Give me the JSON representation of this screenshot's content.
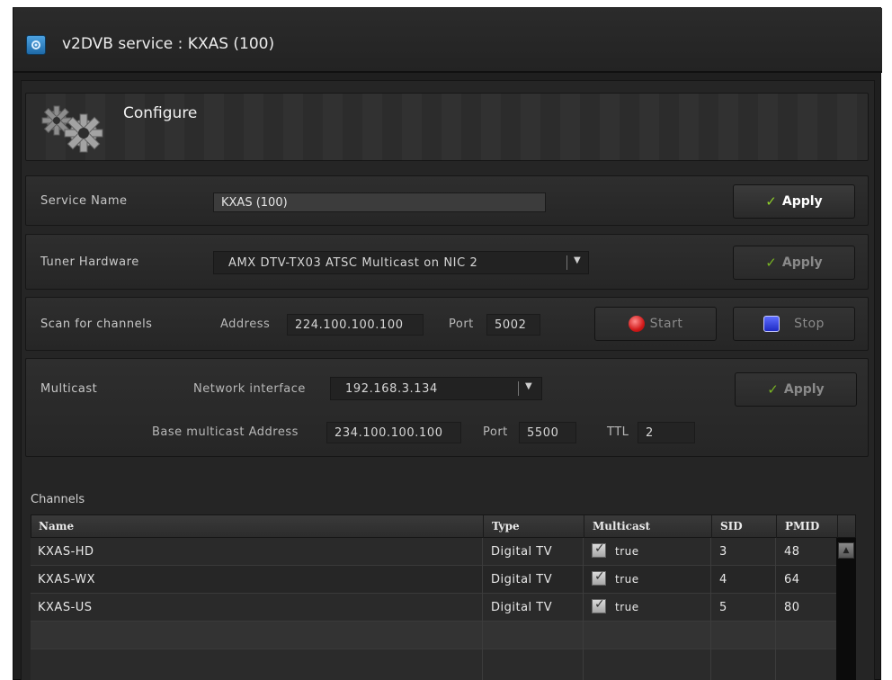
{
  "window": {
    "title": "v2DVB service : KXAS (100)"
  },
  "configure": {
    "title": "Configure"
  },
  "service_name": {
    "label": "Service Name",
    "value": "KXAS (100)",
    "apply_label": "Apply"
  },
  "tuner": {
    "label": "Tuner Hardware",
    "selected": "AMX DTV-TX03 ATSC Multicast on NIC 2",
    "apply_label": "Apply"
  },
  "scan": {
    "label": "Scan for channels",
    "address_label": "Address",
    "address": "224.100.100.100",
    "port_label": "Port",
    "port": "5002",
    "start_label": "Start",
    "stop_label": "Stop"
  },
  "multicast": {
    "label": "Multicast",
    "network_interface_label": "Network interface",
    "network_interface": "192.168.3.134",
    "apply_label": "Apply",
    "base_address_label": "Base multicast Address",
    "base_address": "234.100.100.100",
    "port_label": "Port",
    "port": "5500",
    "ttl_label": "TTL",
    "ttl": "2"
  },
  "channels": {
    "title": "Channels",
    "columns": [
      "Name",
      "Type",
      "Multicast",
      "SID",
      "PMID"
    ],
    "rows": [
      {
        "name": "KXAS-HD",
        "type": "Digital TV",
        "multicast": "true",
        "sid": "3",
        "pmid": "48"
      },
      {
        "name": "KXAS-WX",
        "type": "Digital TV",
        "multicast": "true",
        "sid": "4",
        "pmid": "64"
      },
      {
        "name": "KXAS-US",
        "type": "Digital TV",
        "multicast": "true",
        "sid": "5",
        "pmid": "80"
      }
    ]
  },
  "colors": {
    "apply_check": "#8fd02a",
    "start_icon": "#d21a1a",
    "stop_icon": "#1f2bc4",
    "app_icon": "#2f86c8"
  }
}
